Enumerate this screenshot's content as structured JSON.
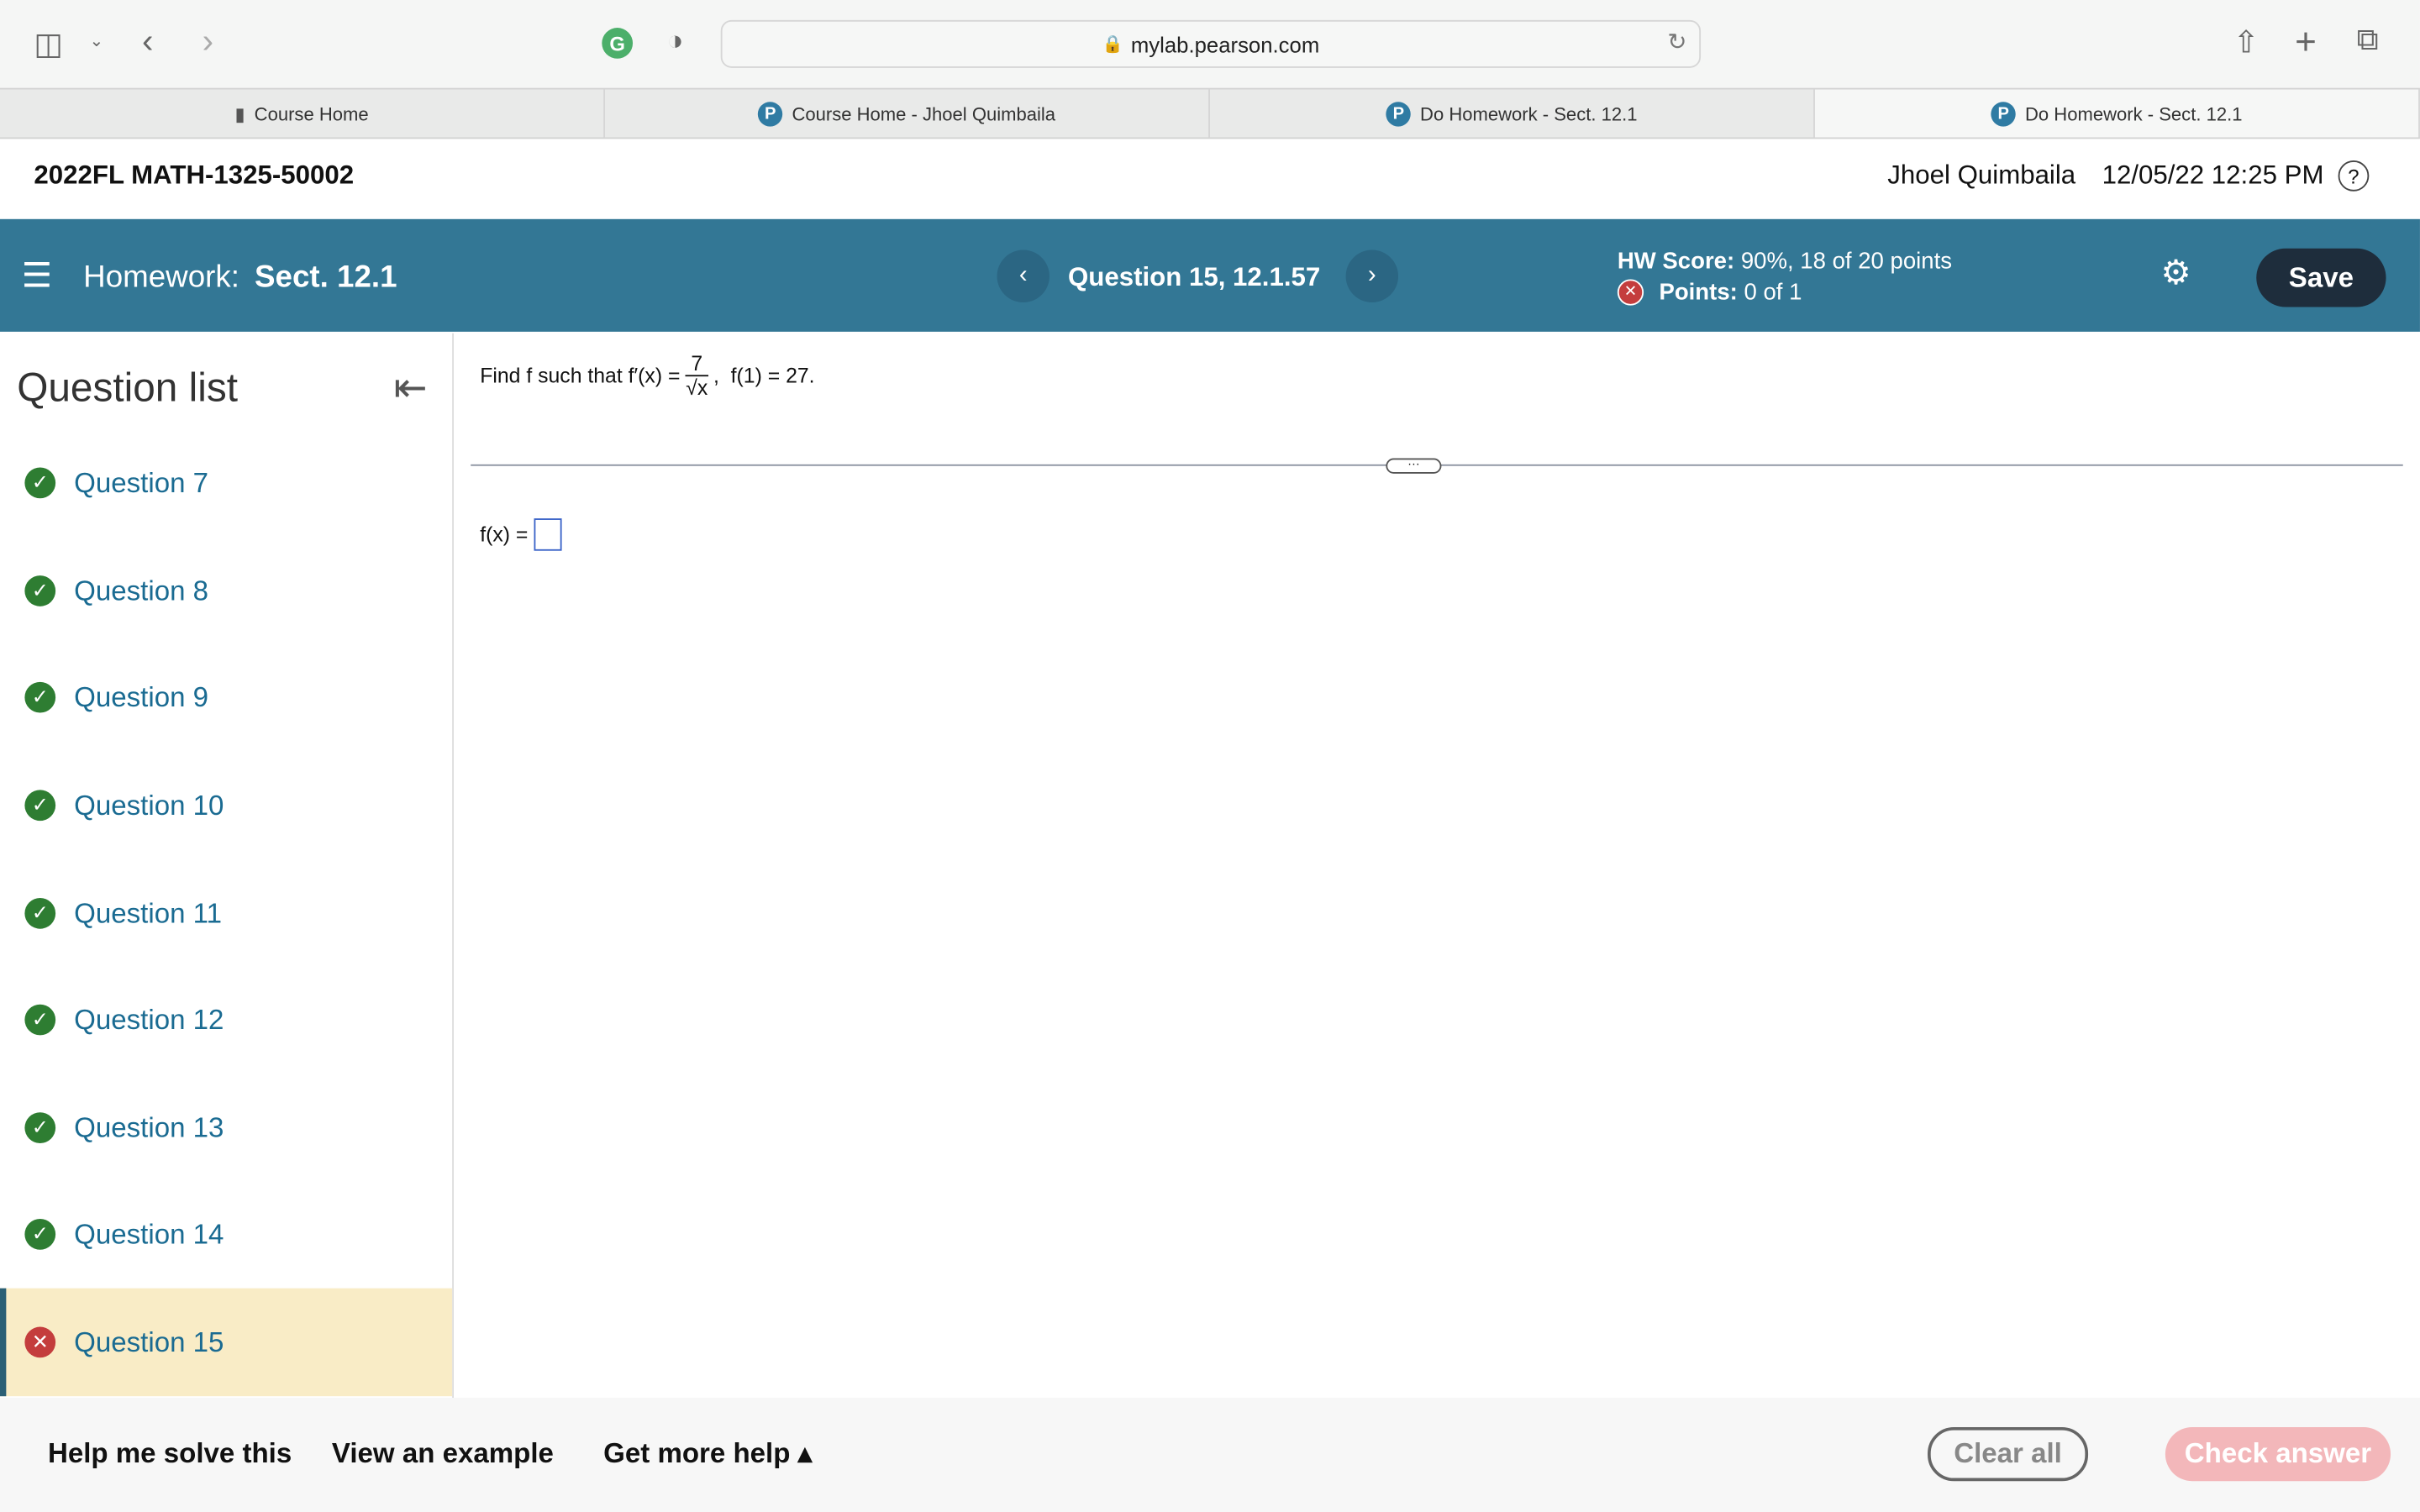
{
  "browser": {
    "url": "mylab.pearson.com",
    "tabs": [
      {
        "label": "Course Home",
        "icon": "book-icon"
      },
      {
        "label": "Course Home - Jhoel Quimbaila",
        "icon": "pearson-icon"
      },
      {
        "label": "Do Homework - Sect. 12.1",
        "icon": "pearson-icon"
      },
      {
        "label": "Do Homework - Sect. 12.1",
        "icon": "pearson-icon",
        "active": true
      }
    ]
  },
  "top": {
    "course": "2022FL MATH-1325-50002",
    "user": "Jhoel Quimbaila",
    "datetime": "12/05/22 12:25 PM",
    "help": "?"
  },
  "header": {
    "hw_label": "Homework:",
    "hw_name": "Sect. 12.1",
    "question": "Question 15, 12.1.57",
    "score_label": "HW Score:",
    "score_value": "90%, 18 of 20 points",
    "points_label": "Points:",
    "points_value": "0 of 1",
    "save": "Save",
    "color": "#337795"
  },
  "sidebar": {
    "title": "Question list",
    "items": [
      {
        "label": "Question 7",
        "status": "correct"
      },
      {
        "label": "Question 8",
        "status": "correct"
      },
      {
        "label": "Question 9",
        "status": "correct"
      },
      {
        "label": "Question 10",
        "status": "correct"
      },
      {
        "label": "Question 11",
        "status": "correct"
      },
      {
        "label": "Question 12",
        "status": "correct"
      },
      {
        "label": "Question 13",
        "status": "correct"
      },
      {
        "label": "Question 14",
        "status": "correct"
      },
      {
        "label": "Question 15",
        "status": "incorrect"
      }
    ]
  },
  "question": {
    "prefix": "Find f such that f′(x) =",
    "numerator": "7",
    "denominator": "√x",
    "suffix": ",  f(1) = 27.",
    "answer_label": "f(x) =",
    "answer_value": ""
  },
  "footer": {
    "help": "Help me solve this",
    "example": "View an example",
    "more": "Get more help ▴",
    "clear": "Clear all",
    "check": "Check answer"
  }
}
